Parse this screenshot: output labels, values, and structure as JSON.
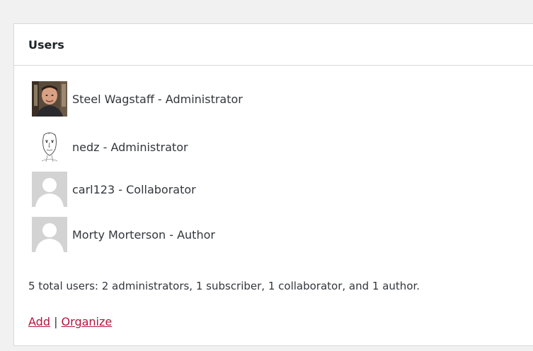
{
  "panel": {
    "title": "Users"
  },
  "users": [
    {
      "label": "Steel Wagstaff - Administrator",
      "avatar": "photo-avatar"
    },
    {
      "label": "nedz - Administrator",
      "avatar": "sketch-avatar"
    },
    {
      "label": "carl123 - Collaborator",
      "avatar": "default-avatar"
    },
    {
      "label": "Morty Morterson - Author",
      "avatar": "default-avatar"
    }
  ],
  "summary": "5 total users: 2 administrators, 1 subscriber, 1 collaborator, and 1 author.",
  "links": {
    "add": "Add",
    "separator": " | ",
    "organize": "Organize"
  },
  "colors": {
    "link": "#b0163f",
    "border": "#d8d8d8",
    "default_avatar_bg": "#d3d3d3",
    "default_avatar_fg": "#ffffff"
  }
}
